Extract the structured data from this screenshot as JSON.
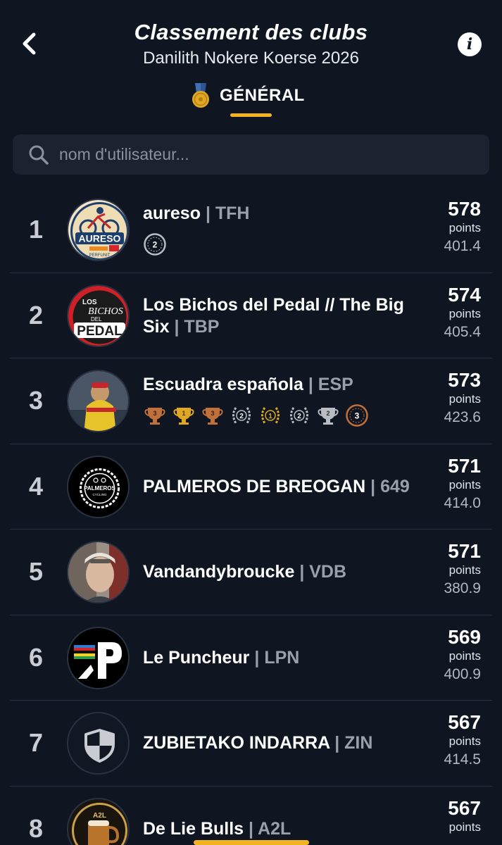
{
  "header": {
    "title": "Classement des clubs",
    "subtitle": "Danilith Nokere Koerse 2026",
    "tab_label": "GÉNÉRAL",
    "info_label": "i"
  },
  "search": {
    "placeholder": "nom d'utilisateur..."
  },
  "rows": [
    {
      "rank": "1",
      "name": "aureso",
      "code": "| TFH",
      "points": "578",
      "points_label": "points",
      "sub": "401.4",
      "badges": [
        "2"
      ]
    },
    {
      "rank": "2",
      "name": "Los Bichos del Pedal // The Big Six ",
      "code": "| TBP",
      "points": "574",
      "points_label": "points",
      "sub": "405.4",
      "badges": []
    },
    {
      "rank": "3",
      "name": "Escuadra española ",
      "code": "| ESP",
      "points": "573",
      "points_label": "points",
      "sub": "423.6",
      "badges": [
        "3",
        "1",
        "3",
        "2",
        "1",
        "2",
        "2",
        "3"
      ]
    },
    {
      "rank": "4",
      "name": "PALMEROS DE BREOGAN ",
      "code": "| 649",
      "points": "571",
      "points_label": "points",
      "sub": "414.0",
      "badges": []
    },
    {
      "rank": "5",
      "name": "Vandandybroucke",
      "code": "| VDB",
      "points": "571",
      "points_label": "points",
      "sub": "380.9",
      "badges": []
    },
    {
      "rank": "6",
      "name": "Le Puncheur",
      "code": "| LPN",
      "points": "569",
      "points_label": "points",
      "sub": "400.9",
      "badges": []
    },
    {
      "rank": "7",
      "name": "ZUBIETAKO INDARRA",
      "code": "| ZIN",
      "points": "567",
      "points_label": "points",
      "sub": "414.5",
      "badges": []
    },
    {
      "rank": "8",
      "name": "De Lie Bulls",
      "code": "| A2L",
      "points": "567",
      "points_label": "points",
      "sub": "",
      "badges": []
    }
  ],
  "logos": {
    "aureso": {
      "text": "AURESO",
      "small": "PERFUNIT"
    },
    "bichos": {
      "top": "LOS",
      "mid": "BICHOS",
      "del": "DEL",
      "bottom": "PEDAL"
    },
    "palmeros": {
      "text": "PALMEROS",
      "small": "CYCLING"
    },
    "a2l": {
      "text": "A2L"
    }
  },
  "colors": {
    "background": "#0f1521",
    "accent": "#f2b320",
    "divider": "#283040",
    "gold": "#e0a722",
    "silver": "#b9bcc2",
    "bronze": "#c0703a"
  }
}
